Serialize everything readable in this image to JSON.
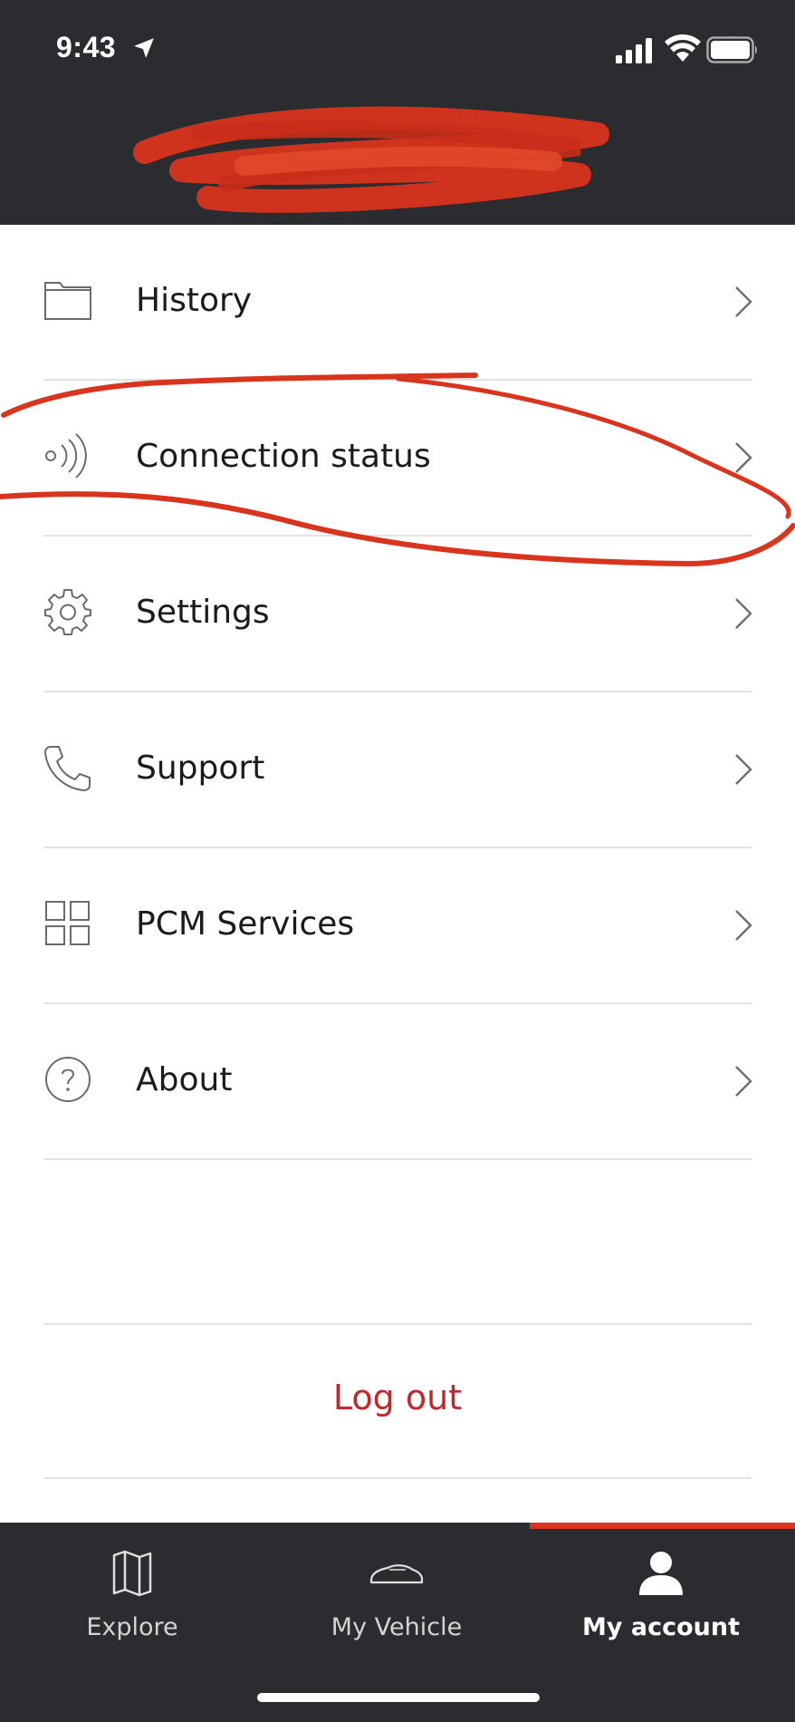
{
  "status_bar": {
    "time": "9:43"
  },
  "colors": {
    "header_bg": "#2b2c30",
    "accent_red": "#c3272b",
    "annotation_red": "#d8341e",
    "text": "#1b1b1b",
    "divider": "#e3e3e3"
  },
  "menu": {
    "items": [
      {
        "label": "History",
        "icon": "folder-icon"
      },
      {
        "label": "Connection status",
        "icon": "wireless-signal-icon"
      },
      {
        "label": "Settings",
        "icon": "gear-icon"
      },
      {
        "label": "Support",
        "icon": "phone-icon"
      },
      {
        "label": "PCM Services",
        "icon": "grid-icon"
      },
      {
        "label": "About",
        "icon": "question-circle-icon"
      }
    ],
    "logout_label": "Log out"
  },
  "tabbar": {
    "tabs": [
      {
        "label": "Explore",
        "icon": "map-icon",
        "active": false
      },
      {
        "label": "My Vehicle",
        "icon": "car-icon",
        "active": false
      },
      {
        "label": "My account",
        "icon": "person-icon",
        "active": true
      }
    ]
  }
}
